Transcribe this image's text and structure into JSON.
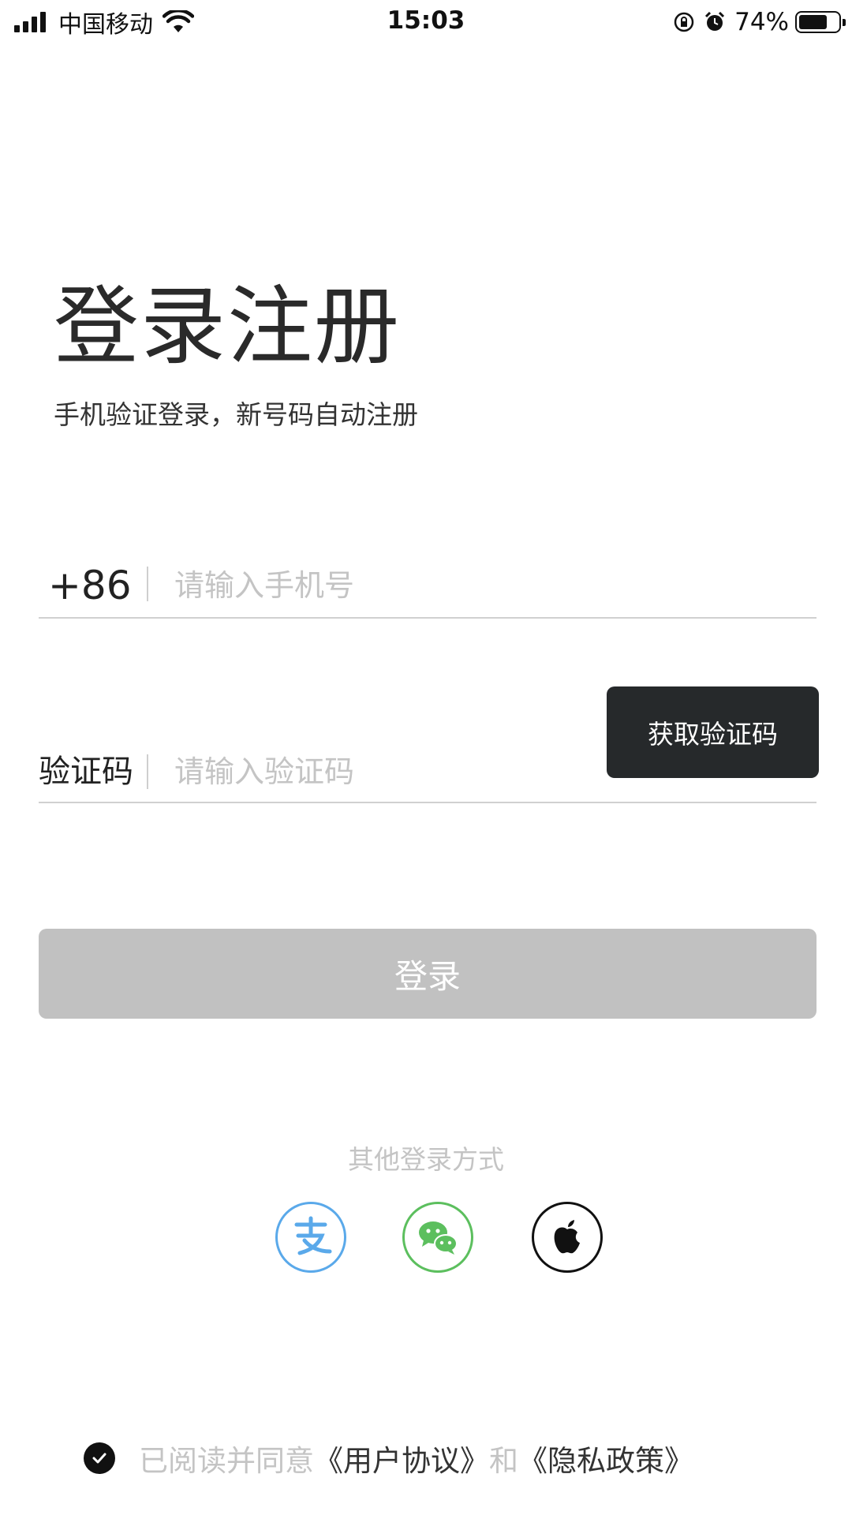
{
  "status_bar": {
    "carrier": "中国移动",
    "time": "15:03",
    "battery_percent_text": "74%",
    "battery_level": 0.74
  },
  "header": {
    "title": "登录注册",
    "subtitle": "手机验证登录，新号码自动注册"
  },
  "phone_field": {
    "prefix": "+86",
    "placeholder": "请输入手机号",
    "value": ""
  },
  "code_field": {
    "label": "验证码",
    "placeholder": "请输入验证码",
    "value": "",
    "get_code_label": "获取验证码"
  },
  "login_button": {
    "label": "登录",
    "enabled": false
  },
  "other_login": {
    "title": "其他登录方式",
    "methods": [
      {
        "name": "alipay",
        "icon": "alipay-icon",
        "color": "#5aa9ea"
      },
      {
        "name": "wechat",
        "icon": "wechat-icon",
        "color": "#5cbf5e"
      },
      {
        "name": "apple",
        "icon": "apple-icon",
        "color": "#111111"
      }
    ]
  },
  "agreement": {
    "checked": true,
    "prefix": "已阅读并同意",
    "user_agreement": "《用户协议》",
    "conjunction": "和",
    "privacy_policy": "《隐私政策》"
  },
  "colors": {
    "primary_dark": "#26292b",
    "disabled_button": "#c1c1c1",
    "placeholder_text": "#c4c4c4"
  }
}
